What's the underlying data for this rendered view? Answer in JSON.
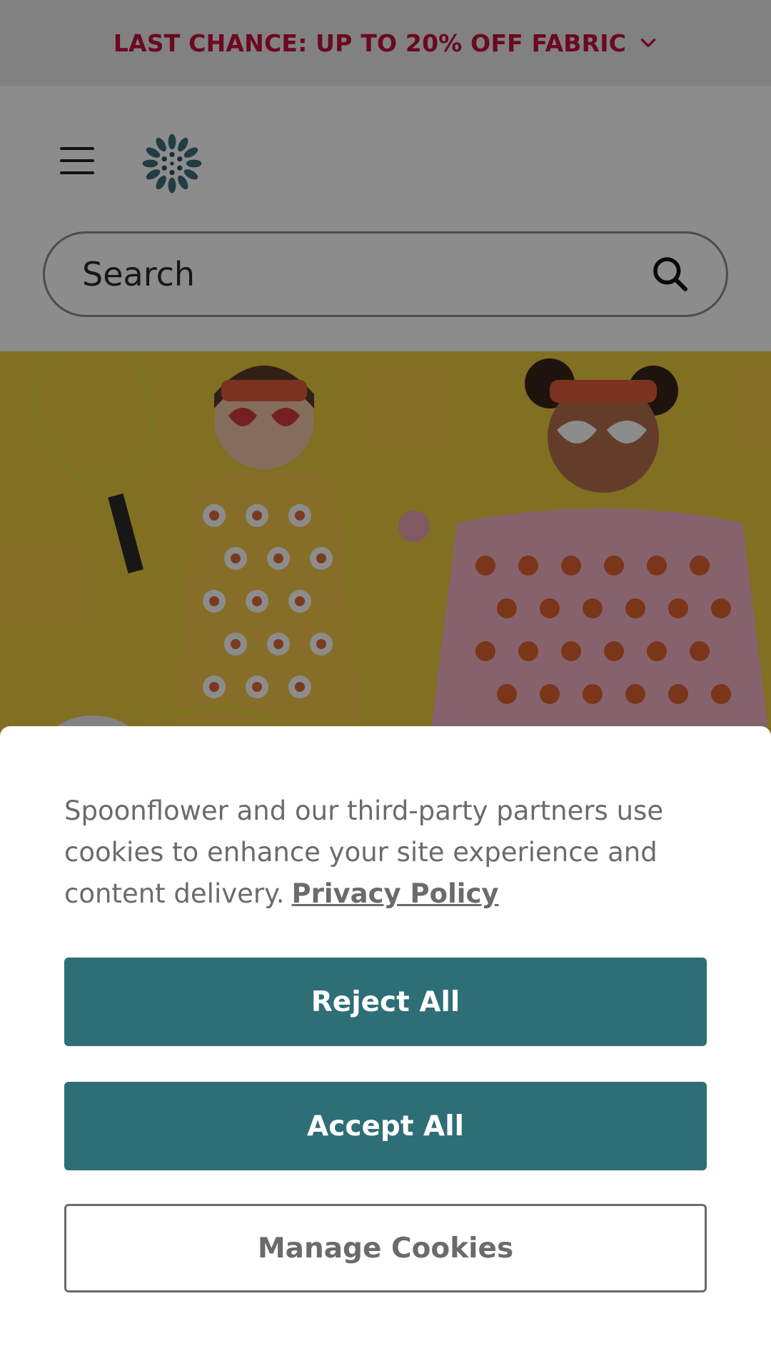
{
  "promo": {
    "text": "LAST CHANCE: UP TO 20% OFF FABRIC",
    "chevron_icon": "chevron-down-icon",
    "color": "#c1123b"
  },
  "header": {
    "menu_icon": "hamburger-menu-icon",
    "logo_icon": "spoonflower-flower-logo-icon",
    "search": {
      "placeholder": "Search",
      "icon": "search-icon"
    }
  },
  "hero": {
    "image": "two women in polka-dot dresses with tennis rackets on yellow background"
  },
  "cookie_banner": {
    "text": "Spoonflower and our third-party partners use cookies to enhance your site experience and content delivery.",
    "privacy_link": "Privacy Policy",
    "reject_label": "Reject All",
    "accept_label": "Accept All",
    "manage_label": "Manage Cookies",
    "accent_color": "#2e6e76"
  }
}
